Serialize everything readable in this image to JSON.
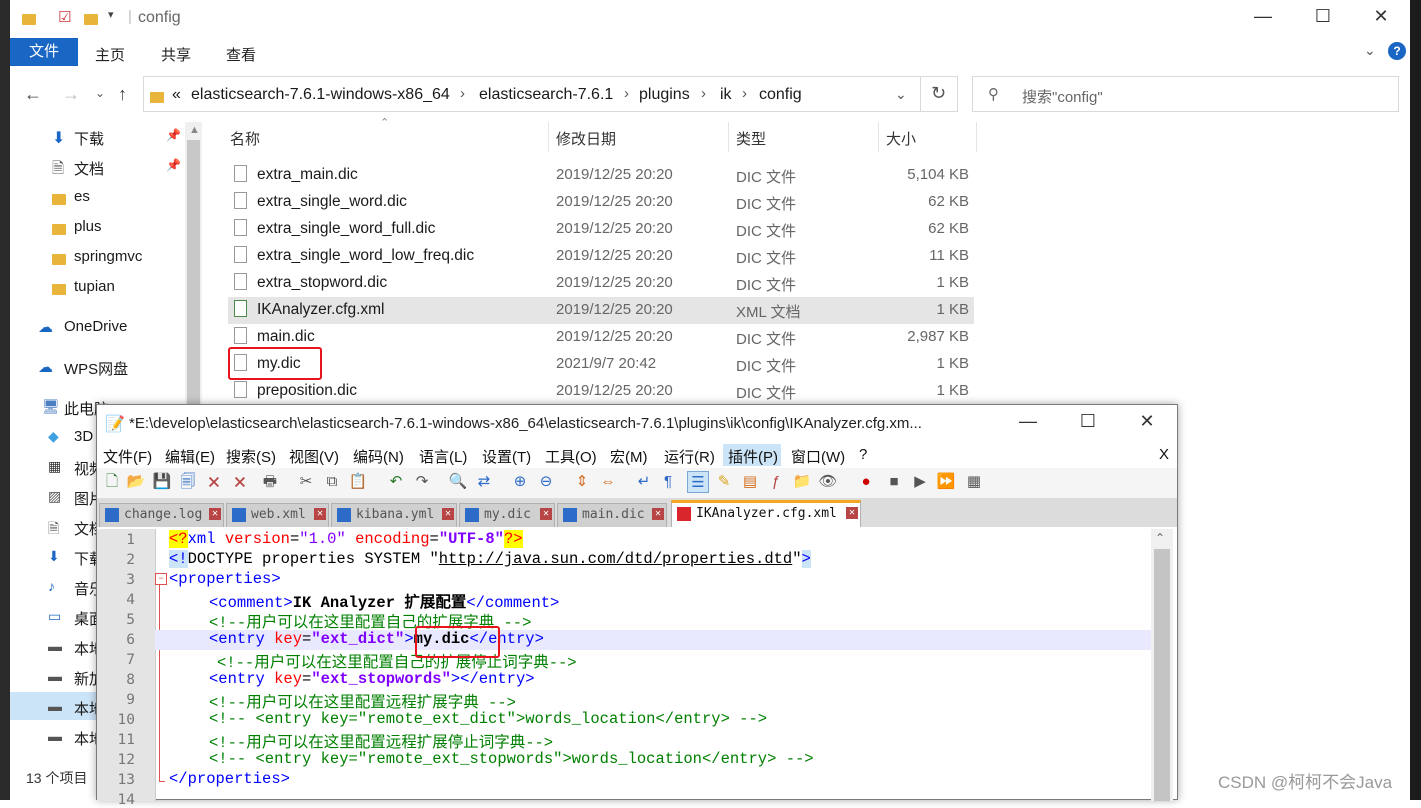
{
  "explorer": {
    "title": "config",
    "ribbon": {
      "file": "文件",
      "home": "主页",
      "share": "共享",
      "view": "查看"
    },
    "breadcrumb": [
      "«",
      "elasticsearch-7.6.1-windows-x86_64",
      "elasticsearch-7.6.1",
      "plugins",
      "ik",
      "config"
    ],
    "search_placeholder": "搜索\"config\"",
    "nav": [
      "下载",
      "文档",
      "es",
      "plus",
      "springmvc",
      "tupian",
      "OneDrive",
      "WPS网盘",
      "此电脑",
      "3D",
      "视频",
      "图片",
      "文档",
      "下载",
      "音乐",
      "桌面",
      "本地",
      "新加",
      "本地",
      "本地"
    ],
    "columns": {
      "name": "名称",
      "date": "修改日期",
      "type": "类型",
      "size": "大小"
    },
    "files": [
      {
        "name": "extra_main.dic",
        "date": "2019/12/25 20:20",
        "type": "DIC 文件",
        "size": "5,104 KB"
      },
      {
        "name": "extra_single_word.dic",
        "date": "2019/12/25 20:20",
        "type": "DIC 文件",
        "size": "62 KB"
      },
      {
        "name": "extra_single_word_full.dic",
        "date": "2019/12/25 20:20",
        "type": "DIC 文件",
        "size": "62 KB"
      },
      {
        "name": "extra_single_word_low_freq.dic",
        "date": "2019/12/25 20:20",
        "type": "DIC 文件",
        "size": "11 KB"
      },
      {
        "name": "extra_stopword.dic",
        "date": "2019/12/25 20:20",
        "type": "DIC 文件",
        "size": "1 KB"
      },
      {
        "name": "IKAnalyzer.cfg.xml",
        "date": "2019/12/25 20:20",
        "type": "XML 文档",
        "size": "1 KB"
      },
      {
        "name": "main.dic",
        "date": "2019/12/25 20:20",
        "type": "DIC 文件",
        "size": "2,987 KB"
      },
      {
        "name": "my.dic",
        "date": "2021/9/7 20:42",
        "type": "DIC 文件",
        "size": "1 KB"
      },
      {
        "name": "preposition.dic",
        "date": "2019/12/25 20:20",
        "type": "DIC 文件",
        "size": "1 KB"
      }
    ],
    "status": "13 个项目"
  },
  "npp": {
    "title": "*E:\\develop\\elasticsearch\\elasticsearch-7.6.1-windows-x86_64\\elasticsearch-7.6.1\\plugins\\ik\\config\\IKAnalyzer.cfg.xm...",
    "menu": [
      "文件(F)",
      "编辑(E)",
      "搜索(S)",
      "视图(V)",
      "编码(N)",
      "语言(L)",
      "设置(T)",
      "工具(O)",
      "宏(M)",
      "运行(R)",
      "插件(P)",
      "窗口(W)",
      "?",
      "X"
    ],
    "tabs": [
      "change.log",
      "web.xml",
      "kibana.yml",
      "my.dic",
      "main.dic",
      "IKAnalyzer.cfg.xml"
    ],
    "line_numbers": [
      "1",
      "2",
      "3",
      "4",
      "5",
      "6",
      "7",
      "8",
      "9",
      "10",
      "11",
      "12",
      "13",
      "14"
    ],
    "code": {
      "l1_a": "<?",
      "l1_b": "xml ",
      "l1_c": "version",
      "l1_d": "=",
      "l1_e": "\"1.0\"",
      "l1_f": " encoding",
      "l1_g": "=",
      "l1_h": "\"UTF-8\"",
      "l1_i": "?>",
      "l2_a": "<!",
      "l2_b": "DOCTYPE properties SYSTEM \"",
      "l2_c": "http://java.sun.com/dtd/properties.dtd",
      "l2_d": "\"",
      "l2_e": ">",
      "l3": "<properties>",
      "l4_a": "<comment>",
      "l4_b": "IK Analyzer 扩展配置",
      "l4_c": "</comment>",
      "l5": "<!--用户可以在这里配置自己的扩展字典 -->",
      "l6_a": "<entry ",
      "l6_b": "key",
      "l6_c": "=",
      "l6_d": "\"ext_dict\"",
      "l6_e": ">",
      "l6_f": "my.dic",
      "l6_g": "</entry>",
      "l7": "<!--用户可以在这里配置自己的扩展停止词字典-->",
      "l8_a": "<entry ",
      "l8_b": "key",
      "l8_c": "=",
      "l8_d": "\"ext_stopwords\"",
      "l8_e": "></entry>",
      "l9": "<!--用户可以在这里配置远程扩展字典 -->",
      "l10": "<!-- <entry key=\"remote_ext_dict\">words_location</entry> -->",
      "l11": "<!--用户可以在这里配置远程扩展停止词字典-->",
      "l12": "<!-- <entry key=\"remote_ext_stopwords\">words_location</entry> -->",
      "l13": "</properties>"
    }
  },
  "watermark": "CSDN @柯柯不会Java"
}
